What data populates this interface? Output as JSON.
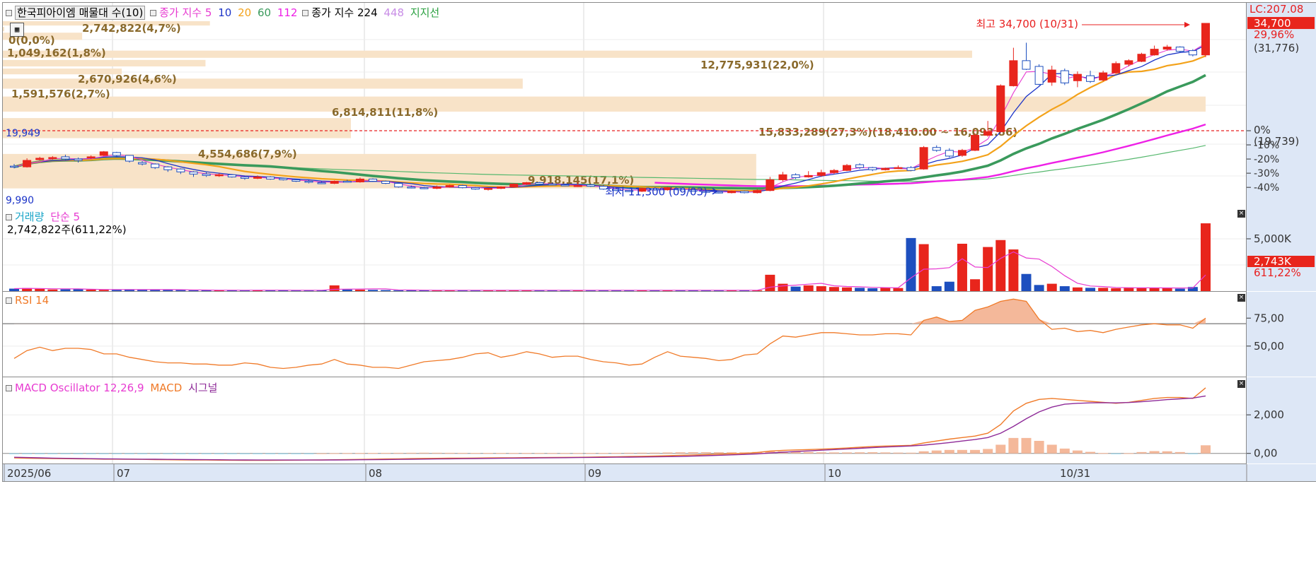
{
  "price_legend": {
    "title": "한국피아이엠 매물대 수(10)",
    "ma_label": "종가 지수",
    "ma_periods": [
      "5",
      "10",
      "20",
      "60",
      "112"
    ],
    "ma2_label": "종가 지수",
    "ma2_periods": [
      "224",
      "448"
    ],
    "support_label": "지지선"
  },
  "volume_legend": {
    "title": "거래량",
    "ma": "단순 5",
    "value": "2,742,822주(611,22%)"
  },
  "rsi_legend": {
    "title": "RSI 14"
  },
  "macd_legend": {
    "title": "MACD Oscillator 12,26,9",
    "macd": "MACD",
    "signal": "시그널"
  },
  "price_axis": {
    "lc": "LC:207.08",
    "current": "34,700",
    "pct": "29,96%",
    "paren": "(31,776)",
    "zero_label": "0%",
    "zero_val": "(19,739)",
    "ticks": [
      "-10%",
      "-20%",
      "-30%",
      "-40%"
    ]
  },
  "volume_axis": {
    "tick": "5,000K",
    "current": "2,743K",
    "pct": "611,22%"
  },
  "rsi_axis": {
    "ticks": [
      "75,00",
      "50,00"
    ]
  },
  "macd_axis": {
    "ticks": [
      "2,000",
      "0,00"
    ]
  },
  "x_axis": {
    "labels": [
      "2025/06",
      "07",
      "08",
      "09",
      "10",
      "10/31"
    ]
  },
  "annotations": {
    "high": "최고 34,700 (10/31)",
    "low": "최저 11,300 (09/03)",
    "left_top": "19,949",
    "left_bottom": "9,990"
  },
  "colors": {
    "up": "#e8251c",
    "down": "#1d4fbf",
    "ma5": "#e73bd1",
    "ma10": "#1c34c8",
    "ma20": "#f3a21a",
    "ma60": "#3a9a5c",
    "ma112": "#ee20e6",
    "ma224": "#56b86e",
    "vp": "#f8e3c8",
    "rsi": "#f07a28",
    "macd": "#f07a28",
    "signal": "#8e2a98",
    "osc": "#f4b89a"
  },
  "chart_data": [
    {
      "type": "candlestick",
      "title": "한국피아이엠",
      "ylim": [
        9990,
        35000
      ],
      "candles": [
        [
          14800,
          14700,
          15100,
          14500
        ],
        [
          14700,
          15600,
          15900,
          14600
        ],
        [
          15700,
          15900,
          16100,
          15600
        ],
        [
          15900,
          16000,
          16200,
          15700
        ],
        [
          16100,
          15800,
          16400,
          15600
        ],
        [
          15800,
          15600,
          16000,
          15300
        ],
        [
          16000,
          16100,
          16300,
          15800
        ],
        [
          16300,
          16800,
          16900,
          16200
        ],
        [
          16700,
          16300,
          16800,
          16000
        ],
        [
          16300,
          15500,
          16300,
          15300
        ],
        [
          15300,
          15100,
          15500,
          14900
        ],
        [
          15100,
          14600,
          15200,
          14400
        ],
        [
          14700,
          14300,
          14800,
          14000
        ],
        [
          14400,
          14000,
          14500,
          13700
        ],
        [
          14000,
          13700,
          14100,
          13300
        ],
        [
          13700,
          13500,
          14000,
          13300
        ],
        [
          13500,
          13600,
          13800,
          13300
        ],
        [
          13600,
          13300,
          13700,
          13200
        ],
        [
          13300,
          13100,
          13400,
          12900
        ],
        [
          13100,
          13300,
          13500,
          13000
        ],
        [
          13300,
          13000,
          13400,
          12900
        ],
        [
          13100,
          12900,
          13200,
          12800
        ],
        [
          12900,
          12700,
          13000,
          12600
        ],
        [
          12700,
          12600,
          12900,
          12400
        ],
        [
          12500,
          12400,
          12700,
          12300
        ],
        [
          12400,
          12700,
          12800,
          12300
        ],
        [
          12700,
          12600,
          12900,
          12500
        ],
        [
          12600,
          13000,
          13200,
          12500
        ],
        [
          13000,
          12700,
          13100,
          12600
        ],
        [
          12700,
          12400,
          12800,
          12300
        ],
        [
          12400,
          11900,
          12500,
          11800
        ],
        [
          11900,
          11800,
          12100,
          11700
        ],
        [
          11800,
          11700,
          11900,
          11600
        ],
        [
          11700,
          11900,
          12100,
          11600
        ],
        [
          11900,
          12100,
          12200,
          11800
        ],
        [
          12100,
          11800,
          12200,
          11700
        ],
        [
          11800,
          11600,
          11900,
          11500
        ],
        [
          11600,
          11700,
          11800,
          11400
        ],
        [
          11700,
          11900,
          12000,
          11600
        ],
        [
          11900,
          12300,
          12400,
          11800
        ],
        [
          12300,
          12500,
          12600,
          12200
        ],
        [
          12500,
          12300,
          12600,
          12200
        ],
        [
          12300,
          12200,
          12500,
          12100
        ],
        [
          12200,
          12100,
          12300,
          12000
        ],
        [
          12100,
          12100,
          12600,
          11900
        ],
        [
          12200,
          12000,
          12300,
          11900
        ],
        [
          12000,
          11600,
          12200,
          11500
        ],
        [
          11600,
          11400,
          11700,
          11300
        ],
        [
          11400,
          11300,
          11500,
          11200
        ],
        [
          11300,
          11700,
          11800,
          11200
        ],
        [
          11700,
          11500,
          11800,
          11400
        ],
        [
          11500,
          11800,
          11900,
          11400
        ],
        [
          11700,
          11500,
          11800,
          11400
        ],
        [
          11500,
          11300,
          11600,
          11300
        ],
        [
          11300,
          11200,
          11400,
          11200
        ],
        [
          11200,
          11100,
          11300,
          11000
        ],
        [
          11100,
          11300,
          11400,
          11000
        ],
        [
          11300,
          11100,
          11400,
          11000
        ],
        [
          11100,
          11400,
          11600,
          11000
        ],
        [
          11400,
          12900,
          13300,
          11300
        ],
        [
          12900,
          13600,
          14000,
          12700
        ],
        [
          13600,
          13200,
          13800,
          13000
        ],
        [
          13300,
          13500,
          14100,
          13200
        ],
        [
          13500,
          13900,
          14300,
          13300
        ],
        [
          13900,
          14200,
          14400,
          13700
        ],
        [
          14200,
          14900,
          15100,
          14100
        ],
        [
          15000,
          14600,
          15200,
          14400
        ],
        [
          14600,
          14300,
          14700,
          14100
        ],
        [
          14300,
          14500,
          14600,
          14200
        ],
        [
          14500,
          14600,
          14900,
          14400
        ],
        [
          14600,
          14200,
          14800,
          14100
        ],
        [
          14400,
          17400,
          17600,
          14300
        ],
        [
          17400,
          17000,
          17700,
          16800
        ],
        [
          17000,
          16200,
          17300,
          16000
        ],
        [
          16300,
          17000,
          17200,
          16100
        ],
        [
          17000,
          19100,
          19400,
          16900
        ],
        [
          19100,
          19600,
          21100,
          18900
        ],
        [
          19600,
          26000,
          26200,
          19500
        ],
        [
          26000,
          29500,
          31300,
          25900
        ],
        [
          29500,
          28300,
          32000,
          28200
        ],
        [
          28700,
          26200,
          29000,
          26100
        ],
        [
          26500,
          28200,
          28800,
          26000
        ],
        [
          28100,
          26400,
          28400,
          26100
        ],
        [
          26700,
          27600,
          28000,
          25800
        ],
        [
          27400,
          26600,
          28100,
          26400
        ],
        [
          26800,
          27800,
          28100,
          26600
        ],
        [
          27800,
          29100,
          29400,
          27700
        ],
        [
          29000,
          29500,
          29700,
          28700
        ],
        [
          29400,
          30400,
          30600,
          29300
        ],
        [
          30300,
          31100,
          31600,
          30200
        ],
        [
          31100,
          31400,
          31700,
          30900
        ],
        [
          31400,
          30800,
          31500,
          30600
        ],
        [
          30900,
          30300,
          31100,
          30100
        ],
        [
          30300,
          34700,
          34700,
          30000
        ]
      ]
    },
    {
      "type": "bar",
      "title": "거래량",
      "values": [
        60,
        75,
        55,
        40,
        45,
        50,
        35,
        30,
        30,
        45,
        40,
        35,
        30,
        25,
        20,
        20,
        20,
        25,
        20,
        25,
        20,
        20,
        20,
        20,
        20,
        140,
        40,
        35,
        30,
        25,
        20,
        20,
        20,
        20,
        20,
        20,
        20,
        20,
        20,
        20,
        20,
        25,
        20,
        20,
        20,
        20,
        20,
        20,
        20,
        20,
        25,
        20,
        20,
        20,
        20,
        20,
        20,
        20,
        20,
        400,
        180,
        110,
        140,
        120,
        100,
        90,
        80,
        70,
        85,
        75,
        1300,
        1150,
        120,
        230,
        1160,
        290,
        1080,
        1250,
        1020,
        420,
        150,
        180,
        120,
        90,
        80,
        80,
        70,
        90,
        80,
        80,
        70,
        60,
        100,
        1660
      ],
      "ylim": [
        0,
        1800
      ]
    },
    {
      "type": "line",
      "title": "RSI 14",
      "values": [
        39,
        46,
        49,
        46,
        48,
        48,
        47,
        43,
        43,
        40,
        38,
        36,
        35,
        35,
        34,
        34,
        33,
        33,
        35,
        34,
        31,
        30,
        31,
        33,
        34,
        38,
        34,
        33,
        31,
        31,
        30,
        33,
        36,
        37,
        38,
        40,
        43,
        44,
        40,
        42,
        45,
        43,
        40,
        41,
        41,
        38,
        36,
        35,
        33,
        34,
        40,
        45,
        41,
        40,
        39,
        37,
        38,
        42,
        43,
        52,
        59,
        58,
        60,
        62,
        62,
        61,
        60,
        60,
        61,
        61,
        60,
        73,
        76,
        72,
        73,
        82,
        85,
        90,
        92,
        90,
        74,
        65,
        66,
        63,
        64,
        62,
        65,
        67,
        69,
        70,
        69,
        69,
        66,
        75
      ],
      "ylim": [
        24,
        96
      ],
      "reference": 70
    },
    {
      "type": "line",
      "title": "MACD Oscillator 12,26,9",
      "series": [
        {
          "name": "MACD",
          "values": [
            -230,
            -250,
            -260,
            -270,
            -275,
            -280,
            -290,
            -300,
            -300,
            -305,
            -310,
            -320,
            -330,
            -335,
            -340,
            -345,
            -350,
            -355,
            -360,
            -360,
            -360,
            -355,
            -350,
            -345,
            -340,
            -330,
            -320,
            -310,
            -300,
            -290,
            -280,
            -270,
            -260,
            -255,
            -250,
            -245,
            -240,
            -235,
            -230,
            -225,
            -220,
            -215,
            -210,
            -205,
            -200,
            -190,
            -180,
            -170,
            -160,
            -150,
            -140,
            -120,
            -100,
            -80,
            -60,
            -40,
            -20,
            0,
            50,
            120,
            160,
            180,
            200,
            220,
            250,
            280,
            320,
            360,
            380,
            400,
            420,
            540,
            640,
            740,
            820,
            900,
            1050,
            1500,
            2200,
            2600,
            2800,
            2850,
            2800,
            2750,
            2700,
            2650,
            2600,
            2650,
            2750,
            2850,
            2900,
            2900,
            2850,
            3400
          ]
        },
        {
          "name": "시그널",
          "values": [
            -200,
            -215,
            -230,
            -245,
            -255,
            -265,
            -275,
            -285,
            -290,
            -295,
            -300,
            -305,
            -310,
            -315,
            -320,
            -325,
            -330,
            -335,
            -340,
            -342,
            -344,
            -345,
            -345,
            -344,
            -343,
            -340,
            -335,
            -330,
            -325,
            -318,
            -310,
            -302,
            -295,
            -288,
            -280,
            -273,
            -266,
            -259,
            -252,
            -245,
            -240,
            -234,
            -228,
            -222,
            -216,
            -210,
            -204,
            -198,
            -192,
            -185,
            -178,
            -168,
            -156,
            -140,
            -120,
            -100,
            -78,
            -55,
            -25,
            20,
            60,
            95,
            130,
            165,
            200,
            230,
            265,
            300,
            330,
            360,
            385,
            430,
            490,
            560,
            640,
            720,
            820,
            1050,
            1400,
            1800,
            2150,
            2400,
            2550,
            2600,
            2620,
            2630,
            2620,
            2640,
            2680,
            2730,
            2790,
            2830,
            2870,
            2980
          ]
        }
      ],
      "ylim": [
        -450,
        3800
      ]
    }
  ],
  "vp_labels": [
    "2,742,822(4,7%)",
    "0(0,0%)",
    "1,049,162(1,8%)",
    "12,775,931(22,0%)",
    "2,670,926(4,6%)",
    "1,591,576(2,7%)",
    "6,814,811(11,8%)",
    "15,833,289(27,3%)(18,410.00 ~ 16,092.86)",
    "4,554,686(7,9%)",
    "9,918,145(17,1%)"
  ]
}
